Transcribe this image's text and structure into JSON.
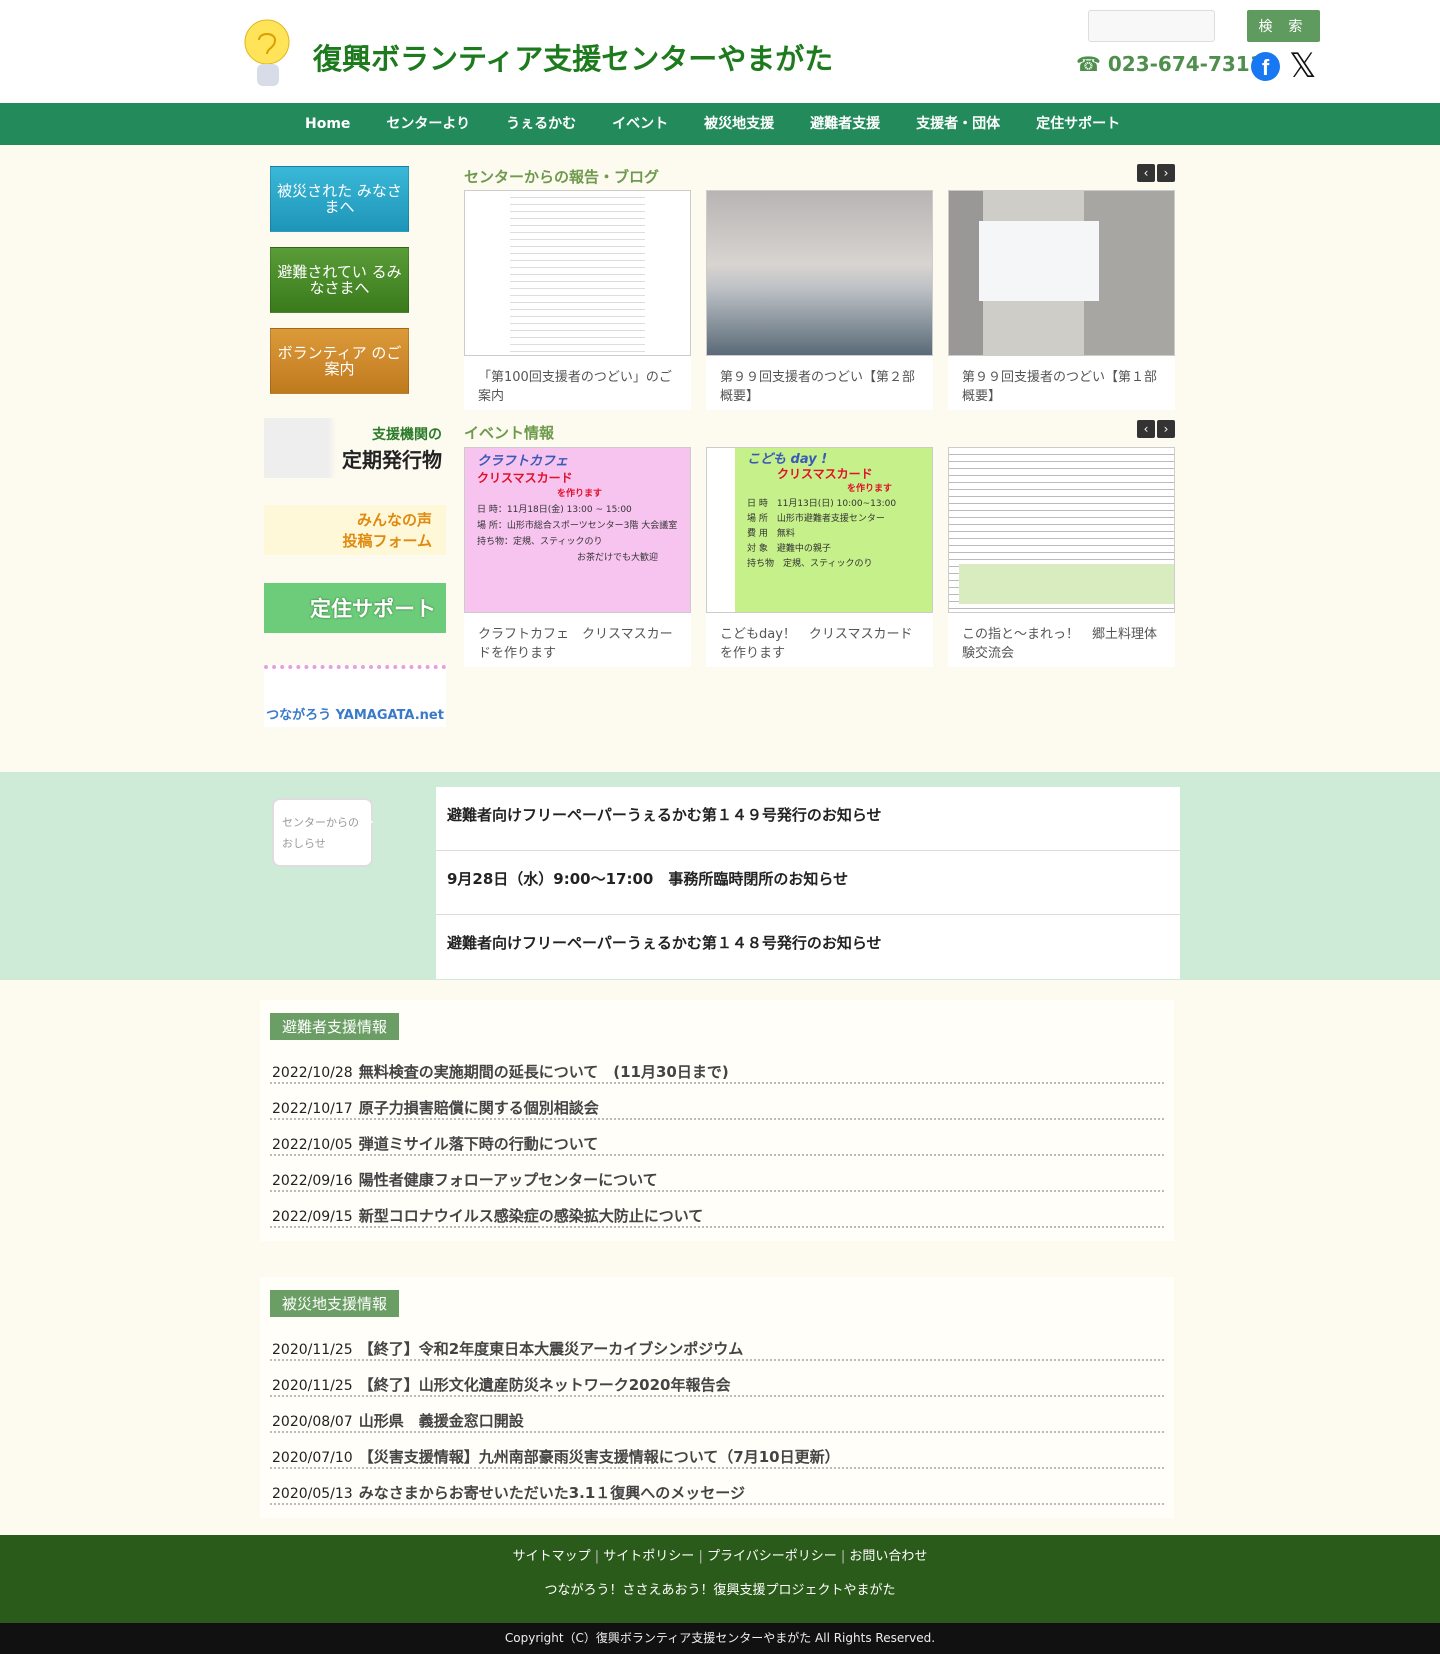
{
  "header": {
    "title": "復興ボランティア支援センターやまがた",
    "search_placeholder": "",
    "search_label": "検 索",
    "phone": "☎ 023-674-7311",
    "facebook_icon": "f",
    "x_icon": "𝕏"
  },
  "nav": [
    "Home",
    "センターより",
    "うぇるかむ",
    "イベント",
    "被災地支援",
    "避難者支援",
    "支援者・団体",
    "定住サポート"
  ],
  "sidebar": {
    "buttons": [
      {
        "label": "被災された みなさまへ",
        "color": "#2aa6c8"
      },
      {
        "label": "避難されてい るみなさまへ",
        "color": "#4a8c2a"
      },
      {
        "label": "ボランティア のご案内",
        "color": "#cc8a2a"
      }
    ],
    "banners": [
      {
        "line1": "支援機関の",
        "line2": "定期発行物"
      },
      {
        "line1": "みんなの声",
        "line2": "投稿フォーム"
      },
      {
        "line1": "定住サポート"
      },
      {
        "line1": "つながろう YAMAGATA.net"
      }
    ]
  },
  "blog": {
    "title": "センターからの報告・ブログ",
    "cards": [
      "「第100回支援者のつどい」のご案内",
      "第９９回支援者のつどい【第２部概要】",
      "第９９回支援者のつどい【第１部概要】"
    ]
  },
  "events": {
    "title": "イベント情報",
    "cards": [
      "クラフトカフェ　クリスマスカードを作ります",
      "こどもday！　クリスマスカードを作ります",
      "この指と～まれっ！　郷土料理体験交流会"
    ],
    "flyer1": {
      "heading": "クラフトカフェ",
      "title": "クリスマスカード",
      "sub": "を作ります",
      "date": "日 時：11月18日(金) 13:00 ~ 15:00",
      "place": "場 所：山形市総合スポーツセンター3階 大会議室",
      "bring": "持ち物：定規、スティックのり",
      "note": "お茶だけでも大歓迎"
    },
    "flyer2": {
      "heading": "こども day !",
      "title": "クリスマスカード",
      "sub": "を作ります",
      "date": "日 時　11月13日(日) 10:00~13:00",
      "place": "場 所　山形市避難者支援センター",
      "fee": "費 用　無料",
      "target": "対 象　避難中の親子",
      "bring": "持ち物　定規、スティックのり"
    }
  },
  "notices": {
    "label": "センターからのおしらせ",
    "items": [
      "避難者向けフリーペーパーうぇるかむ第１４９号発行のお知らせ",
      "9月28日（水）9:00～17:00　事務所臨時閉所のお知らせ",
      "避難者向けフリーペーパーうぇるかむ第１４８号発行のお知らせ"
    ]
  },
  "evacuee_info": {
    "title": "避難者支援情報",
    "items": [
      {
        "date": "2022/10/28",
        "text": "無料検査の実施期間の延長について　(11月30日まで)"
      },
      {
        "date": "2022/10/17",
        "text": "原子力損害賠償に関する個別相談会"
      },
      {
        "date": "2022/10/05",
        "text": "弾道ミサイル落下時の行動について"
      },
      {
        "date": "2022/09/16",
        "text": "陽性者健康フォローアップセンターについて"
      },
      {
        "date": "2022/09/15",
        "text": "新型コロナウイルス感染症の感染拡大防止について"
      }
    ]
  },
  "disaster_info": {
    "title": "被災地支援情報",
    "items": [
      {
        "date": "2020/11/25",
        "text": "【終了】令和2年度東日本大震災アーカイブシンポジウム"
      },
      {
        "date": "2020/11/25",
        "text": "【終了】山形文化遺産防災ネットワーク2020年報告会"
      },
      {
        "date": "2020/08/07",
        "text": "山形県　義援金窓口開設"
      },
      {
        "date": "2020/07/10",
        "text": "【災害支援情報】九州南部豪雨災害支援情報について（7月10日更新）"
      },
      {
        "date": "2020/05/13",
        "text": "みなさまからお寄せいただいた3.1１復興へのメッセージ"
      }
    ]
  },
  "footer": {
    "links": [
      "サイトマップ",
      "サイトポリシー",
      "プライバシーポリシー",
      "お問い合わせ"
    ],
    "tagline": "つながろう！ささえあおう！復興支援プロジェクトやまがた",
    "copyright": "Copyright（C）復興ボランティア支援センターやまがた All Rights Reserved."
  }
}
